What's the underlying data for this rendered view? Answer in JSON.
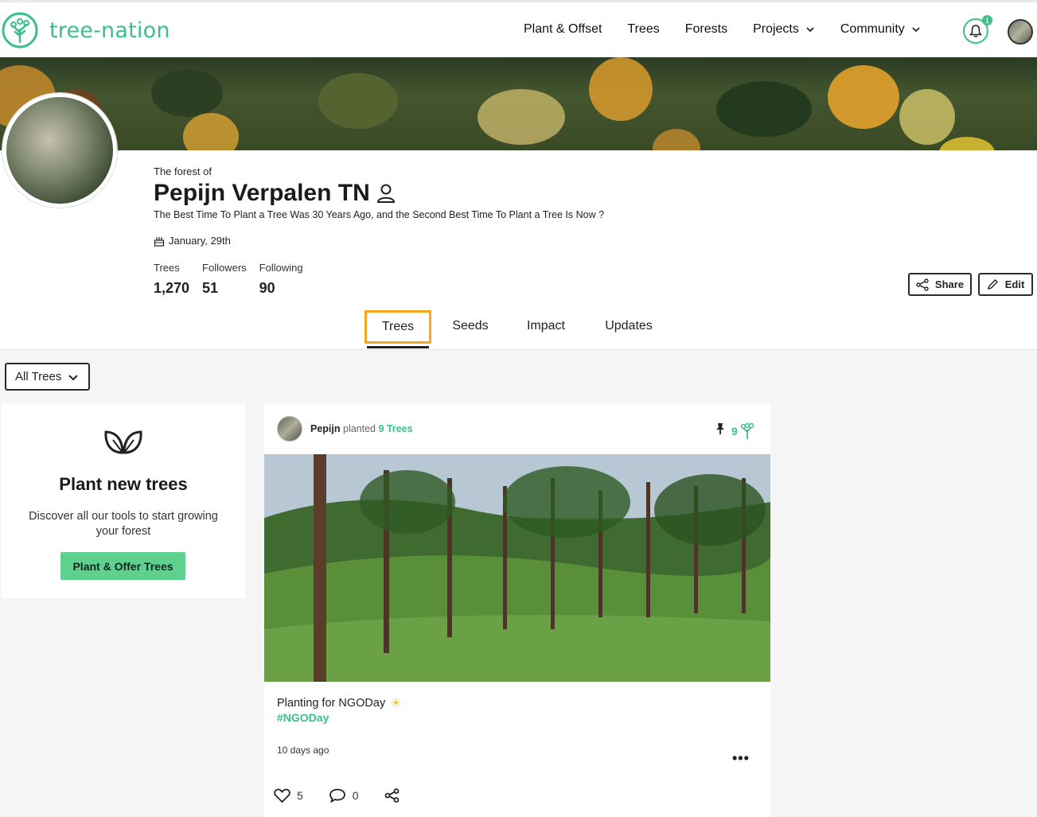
{
  "header": {
    "logo_text": "tree-nation",
    "nav": [
      {
        "label": "Plant & Offset",
        "dropdown": false
      },
      {
        "label": "Trees",
        "dropdown": false
      },
      {
        "label": "Forests",
        "dropdown": false
      },
      {
        "label": "Projects",
        "dropdown": true
      },
      {
        "label": "Community",
        "dropdown": true
      }
    ],
    "notification_count": "1"
  },
  "profile": {
    "forest_of": "The forest of",
    "name": "Pepijn Verpalen TN",
    "bio": "The Best Time To Plant a Tree Was 30 Years Ago, and the Second Best Time To Plant a Tree Is Now ?",
    "date": "January, 29th",
    "stats": [
      {
        "label": "Trees",
        "value": "1,270"
      },
      {
        "label": "Followers",
        "value": "51"
      },
      {
        "label": "Following",
        "value": "90"
      }
    ],
    "share_label": "Share",
    "edit_label": "Edit"
  },
  "tabs": [
    {
      "label": "Trees",
      "active": true
    },
    {
      "label": "Seeds",
      "active": false
    },
    {
      "label": "Impact",
      "active": false
    },
    {
      "label": "Updates",
      "active": false
    }
  ],
  "filter": {
    "label": "All Trees"
  },
  "plant_card": {
    "title": "Plant new trees",
    "description": "Discover all our tools to start growing your forest",
    "button": "Plant & Offer Trees"
  },
  "post": {
    "author": "Pepijn",
    "action": "planted",
    "trees": "9 Trees",
    "tree_count": "9",
    "text": "Planting for NGODay",
    "tag": "#NGODay",
    "time": "10 days ago",
    "likes": "5",
    "comments": "0"
  },
  "colors": {
    "brand": "#3cbf8a",
    "highlight": "#f3a81d",
    "button_green": "#5fd18f"
  }
}
